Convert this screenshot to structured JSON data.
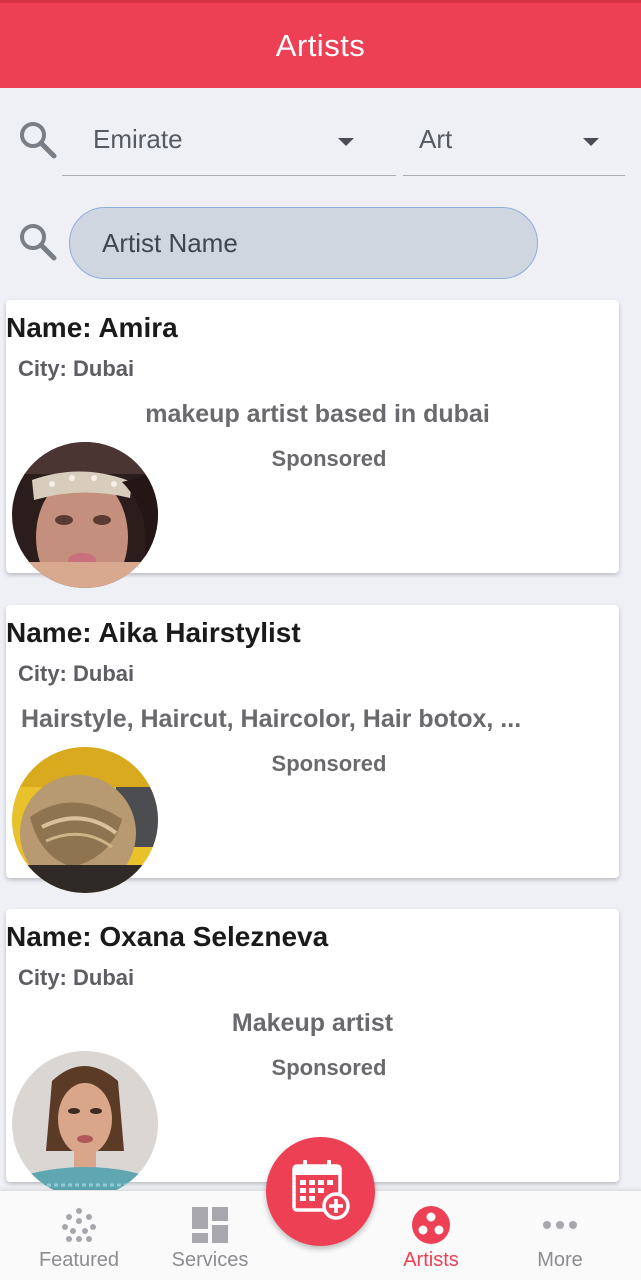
{
  "header": {
    "title": "Artists"
  },
  "filters": {
    "emirate": {
      "value": "Emirate",
      "icon": "chevron-down-icon"
    },
    "art": {
      "value": "Art",
      "icon": "chevron-down-icon"
    },
    "search_icon": "search-icon",
    "artist_name": {
      "placeholder": "Artist Name",
      "value": ""
    }
  },
  "artists": [
    {
      "name": "Name: Amira",
      "city": "City: Dubai",
      "description": "makeup artist based in dubai",
      "sponsored": "Sponsored"
    },
    {
      "name": "Name: Aika Hairstylist",
      "city": "City: Dubai",
      "description": "Hairstyle, Haircut, Haircolor, Hair botox, ...",
      "sponsored": "Sponsored"
    },
    {
      "name": "Name: Oxana Selezneva",
      "city": "City: Dubai",
      "description": "Makeup artist",
      "sponsored": "Sponsored"
    }
  ],
  "bottom_nav": {
    "items": [
      {
        "label": "Featured",
        "icon": "featured-dots-icon"
      },
      {
        "label": "Services",
        "icon": "services-grid-icon"
      },
      {
        "label": "Artists",
        "icon": "artists-circle-icon",
        "active": true
      },
      {
        "label": "More",
        "icon": "more-dots-icon"
      }
    ],
    "fab_icon": "calendar-add-icon"
  },
  "colors": {
    "primary": "#ee4055",
    "background": "#eef0f6",
    "input_fill": "#cfd6e0"
  }
}
